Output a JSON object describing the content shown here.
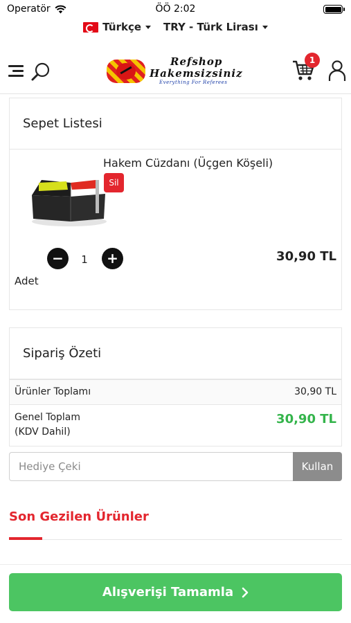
{
  "status_bar": {
    "carrier": "Operatör",
    "time": "ÖÖ 2:02"
  },
  "locale_bar": {
    "language": "Türkçe",
    "currency": "TRY - Türk Lirası"
  },
  "header": {
    "logo_line1": "Refshop",
    "logo_line2": "Hakemsizsiniz",
    "logo_tagline": "Everything For Referees",
    "cart_count": "1"
  },
  "cart": {
    "title": "Sepet Listesi",
    "items": [
      {
        "name": "Hakem Cüzdanı (Üçgen Köşeli)",
        "remove_label": "Sil",
        "quantity": "1",
        "quantity_label": "Adet",
        "price": "30,90 TL"
      }
    ]
  },
  "summary": {
    "title": "Sipariş Özeti",
    "subtotal_label": "Ürünler Toplamı",
    "subtotal_value": "30,90 TL",
    "total_label_line1": "Genel Toplam",
    "total_label_line2": "(KDV Dahil)",
    "total_value": "30,90 TL"
  },
  "gift": {
    "placeholder": "Hediye Çeki",
    "button": "Kullan"
  },
  "recent": {
    "title": "Son Gezilen Ürünler"
  },
  "checkout": {
    "label": "Alışverişi Tamamla"
  },
  "colors": {
    "accent_red": "#e3262e",
    "success_green": "#4cc562",
    "total_green": "#34b44b"
  }
}
